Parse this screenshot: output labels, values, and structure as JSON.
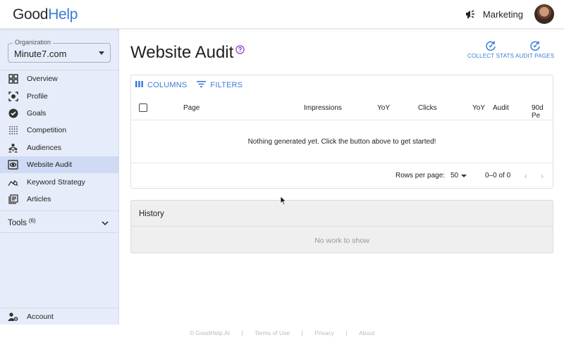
{
  "header": {
    "logo_part1": "Good",
    "logo_part2": "Help",
    "org_label": "Marketing",
    "megaphone_icon": "megaphone-icon"
  },
  "sidebar": {
    "org_legend": "Organization",
    "org_value": "Minute7.com",
    "items": [
      {
        "label": "Overview",
        "icon": "grid-icon"
      },
      {
        "label": "Profile",
        "icon": "profile-icon"
      },
      {
        "label": "Goals",
        "icon": "check-circle-icon"
      },
      {
        "label": "Competition",
        "icon": "dots-grid-icon"
      },
      {
        "label": "Audiences",
        "icon": "audiences-icon"
      },
      {
        "label": "Website Audit",
        "icon": "eye-box-icon"
      },
      {
        "label": "Keyword Strategy",
        "icon": "keyword-chart-icon"
      },
      {
        "label": "Articles",
        "icon": "articles-icon"
      }
    ],
    "active_index": 5,
    "tools_label": "Tools",
    "tools_count": "(6)",
    "account_label": "Account"
  },
  "main": {
    "title": "Website Audit",
    "actions": {
      "collect_stats": "COLLECT STATS",
      "audit_pages": "AUDIT PAGES"
    },
    "toolbar": {
      "columns": "COLUMNS",
      "filters": "FILTERS"
    },
    "columns": [
      "Page",
      "Impressions",
      "YoY",
      "Clicks",
      "YoY",
      "Audit",
      "90d Pe"
    ],
    "empty_message": "Nothing generated yet. Click the button above to get started!",
    "pager": {
      "rows_per_page_label": "Rows per page:",
      "rows_per_page_value": "50",
      "range": "0–0 of 0"
    },
    "history": {
      "title": "History",
      "empty": "No work to show"
    }
  },
  "footer": {
    "copyright": "© GoodHelp.AI",
    "sep": "|",
    "terms": "Terms of Use",
    "privacy": "Privacy",
    "about": "About"
  },
  "colors": {
    "accent": "#3a7bd5",
    "sidebar_bg": "#e6ecf9",
    "sidebar_active": "#cfdbf4",
    "help_icon": "#8a3fbf"
  }
}
